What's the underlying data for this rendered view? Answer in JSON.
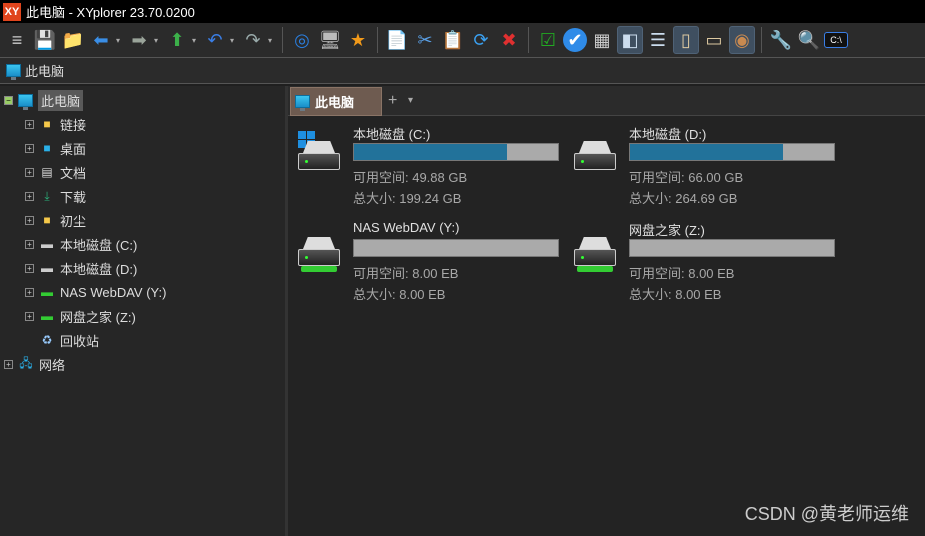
{
  "window": {
    "title": "此电脑 - XYplorer 23.70.0200",
    "logo": "XY"
  },
  "toolbar": {
    "icons": [
      "menu-icon",
      "save-icon",
      "new-folder-icon",
      "back-icon",
      "forward-icon",
      "up-icon",
      "undo-icon",
      "redo-icon",
      "target-icon",
      "computer-icon",
      "favorites-icon",
      "copy-icon",
      "cut-icon",
      "paste-icon",
      "refresh-icon",
      "delete-icon",
      "checkbox-icon",
      "check-icon",
      "view-icon",
      "layout-icon",
      "dual-pane-icon",
      "preview-icon",
      "info-panel-icon",
      "tags-icon",
      "tools-icon",
      "search-icon",
      "terminal-icon"
    ]
  },
  "address": {
    "path": "此电脑"
  },
  "tree": {
    "root": "此电脑",
    "items": [
      "链接",
      "桌面",
      "文档",
      "下载",
      "初尘",
      "本地磁盘 (C:)",
      "本地磁盘 (D:)",
      "NAS WebDAV (Y:)",
      "网盘之家 (Z:)",
      "回收站"
    ],
    "network": "网络"
  },
  "tabs": {
    "active": "此电脑",
    "add": "+",
    "menu": "▾"
  },
  "drives": [
    {
      "name": "本地磁盘 (C:)",
      "used_fraction": 0.75,
      "free": "可用空间: 49.88 GB",
      "total": "总大小: 199.24 GB"
    },
    {
      "name": "本地磁盘 (D:)",
      "used_fraction": 0.75,
      "free": "可用空间: 66.00 GB",
      "total": "总大小: 264.69 GB"
    },
    {
      "name": "NAS WebDAV (Y:)",
      "used_fraction": 0,
      "free": "可用空间: 8.00 EB",
      "total": "总大小: 8.00 EB"
    },
    {
      "name": "网盘之家 (Z:)",
      "used_fraction": 0,
      "free": "可用空间: 8.00 EB",
      "total": "总大小: 8.00 EB"
    }
  ],
  "watermark": "CSDN @黄老师运维"
}
